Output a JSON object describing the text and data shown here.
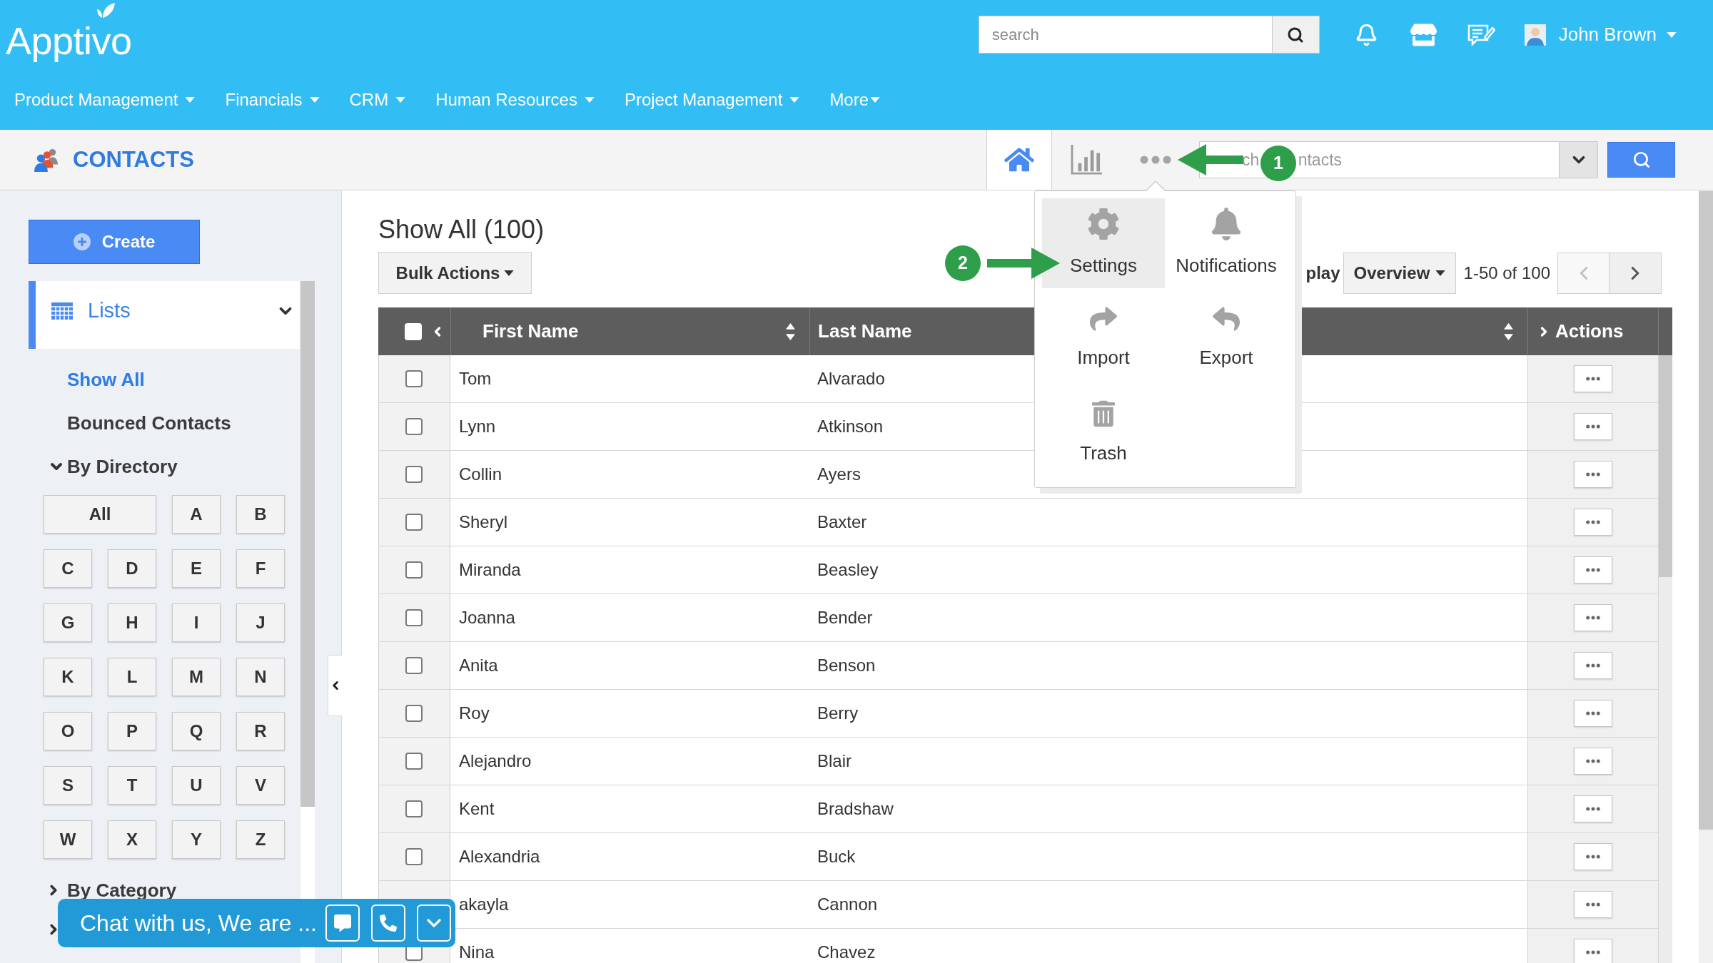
{
  "header": {
    "logo": "Apptivo",
    "search": {
      "placeholder": "search"
    },
    "user_name": "John Brown"
  },
  "nav": [
    {
      "label": "Product Management"
    },
    {
      "label": "Financials"
    },
    {
      "label": "CRM"
    },
    {
      "label": "Human Resources"
    },
    {
      "label": "Project Management"
    },
    {
      "label": "More"
    }
  ],
  "app_bar": {
    "title": "CONTACTS",
    "tabs": [
      {
        "selected": true
      },
      {
        "selected": false
      },
      {
        "selected": false
      }
    ],
    "search_field": {
      "placeholder": "ch ntacts"
    }
  },
  "more_menu": {
    "items": [
      {
        "label": "Settings",
        "selected": true
      },
      {
        "label": "Notifications",
        "selected": false
      },
      {
        "label": "Import",
        "selected": false
      },
      {
        "label": "Export",
        "selected": false
      },
      {
        "label": "Trash",
        "selected": false
      }
    ]
  },
  "annotations": [
    {
      "label": "1"
    },
    {
      "label": "2"
    }
  ],
  "sidebar": {
    "create_button": "Create",
    "lists": {
      "label": "Lists",
      "expanded": true
    },
    "items": [
      {
        "label": "Show All",
        "selected": true
      },
      {
        "label": "Bounced Contacts",
        "selected": false
      }
    ],
    "groups": [
      {
        "label": "By Directory",
        "expanded": true,
        "letters": [
          "All",
          "A",
          "B",
          "C",
          "D",
          "E",
          "F",
          "G",
          "H",
          "I",
          "J",
          "K",
          "L",
          "M",
          "N",
          "O",
          "P",
          "Q",
          "R",
          "S",
          "T",
          "U",
          "V",
          "W",
          "X",
          "Y",
          "Z"
        ]
      },
      {
        "label": "By Category",
        "expanded": false
      },
      {
        "expanded": false
      }
    ]
  },
  "content": {
    "title": "Show All (100)",
    "bulk_actions": "Bulk Actions",
    "display_label": "play",
    "view_select": {
      "value": "Overview"
    },
    "range": "1-50 of 100",
    "pager": [
      {
        "disabled": true
      },
      {
        "disabled": false
      }
    ]
  },
  "table": {
    "select_all": {
      "checked": false
    },
    "columns": [
      {
        "label": "First Name",
        "sortable": true
      },
      {
        "label": "Last Name"
      },
      {
        "sortable": true
      }
    ],
    "actions_header": "Actions",
    "rows": [
      {
        "first_name": "Tom",
        "last_name": "Alvarado",
        "checked": false
      },
      {
        "first_name": "Lynn",
        "last_name": "Atkinson",
        "checked": false
      },
      {
        "first_name": "Collin",
        "last_name": "Ayers",
        "checked": false
      },
      {
        "first_name": "Sheryl",
        "last_name": "Baxter",
        "checked": false
      },
      {
        "first_name": "Miranda",
        "last_name": "Beasley",
        "checked": false
      },
      {
        "first_name": "Joanna",
        "last_name": "Bender",
        "checked": false
      },
      {
        "first_name": "Anita",
        "last_name": "Benson",
        "checked": false
      },
      {
        "first_name": "Roy",
        "last_name": "Berry",
        "checked": false
      },
      {
        "first_name": "Alejandro",
        "last_name": "Blair",
        "checked": false
      },
      {
        "first_name": "Kent",
        "last_name": "Bradshaw",
        "checked": false
      },
      {
        "first_name": "Alexandria",
        "last_name": "Buck",
        "checked": false
      },
      {
        "first_name": "akayla",
        "last_name": "Cannon"
      },
      {
        "first_name": "Nina",
        "last_name": "Chavez",
        "checked": false
      }
    ]
  },
  "chat_widget": {
    "text": "Chat with us, We are ..."
  }
}
